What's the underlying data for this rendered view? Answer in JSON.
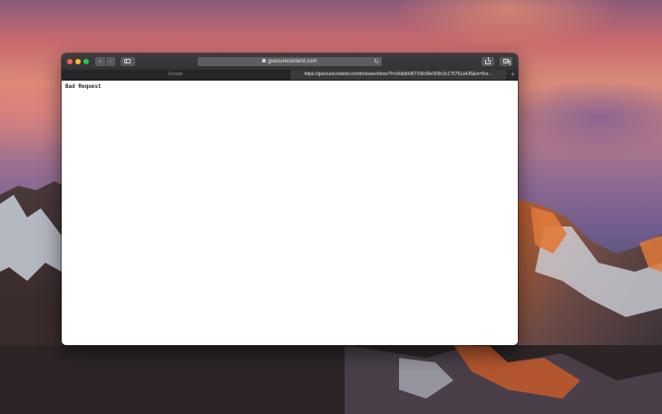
{
  "browser": {
    "address_text": "gsecurecontent.com",
    "tabs": [
      {
        "label": "Google"
      },
      {
        "label": "https://gsecurecontent.com/browser/show?l=c9da5b9671f9c90e909c3c175761a436&m=5vr..."
      }
    ],
    "new_tab_label": "+",
    "reload_glyph": "↻",
    "back_glyph": "‹",
    "forward_glyph": "›"
  },
  "page": {
    "message": "Bad Request"
  }
}
